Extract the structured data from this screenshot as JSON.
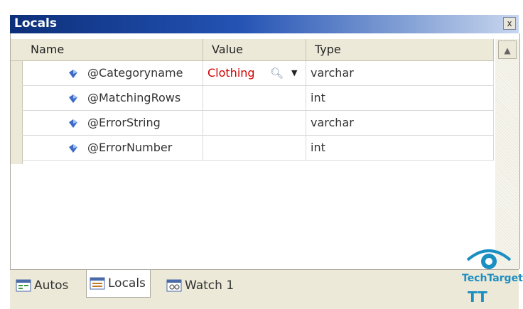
{
  "window": {
    "title": "Locals",
    "close_label": "x"
  },
  "grid": {
    "columns": [
      {
        "label": "Name"
      },
      {
        "label": "Value"
      },
      {
        "label": "Type"
      }
    ],
    "rows": [
      {
        "name": "@Categoryname",
        "value": "Clothing",
        "type": "varchar",
        "has_visualizer": true
      },
      {
        "name": "@MatchingRows",
        "value": "",
        "type": "int",
        "has_visualizer": false
      },
      {
        "name": "@ErrorString",
        "value": "",
        "type": "varchar",
        "has_visualizer": false
      },
      {
        "name": "@ErrorNumber",
        "value": "",
        "type": "int",
        "has_visualizer": false
      }
    ],
    "value_color": "#d00000"
  },
  "tabs": [
    {
      "label": "Autos",
      "icon": "autos-window-icon",
      "active": false
    },
    {
      "label": "Locals",
      "icon": "locals-window-icon",
      "active": true
    },
    {
      "label": "Watch 1",
      "icon": "watch-window-icon",
      "active": false
    }
  ],
  "watermark": {
    "brand": "TechTarget",
    "mark": "TT"
  },
  "colors": {
    "titlebar_start": "#0c2f7a",
    "titlebar_end": "#c9d6ee",
    "tabbar": "#ece9d8"
  }
}
